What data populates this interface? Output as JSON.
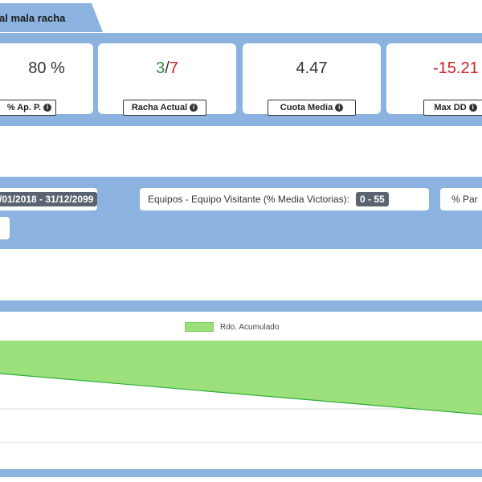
{
  "tab": {
    "label": "al mala racha"
  },
  "stats": [
    {
      "value": "80 %",
      "label": "% Ap. P.",
      "color": "#333333"
    },
    {
      "value_good": "3",
      "value_sep": "/",
      "value_bad": "7",
      "label": "Racha Actual"
    },
    {
      "value": "4.47",
      "label": "Cuota Media",
      "color": "#333333"
    },
    {
      "value": "-15.21",
      "label": "Max DD",
      "color": "#cc2222"
    }
  ],
  "colors": {
    "band": "#8cb3df",
    "positive": "#3a8a3a",
    "negative": "#cc2222",
    "area": "#9be07a",
    "area_line": "#2fae3a"
  },
  "filters": {
    "date_range": "/01/2018 - 31/12/2099",
    "equipos_label": "Equipos - Equipo Visitante (% Media Victorias):",
    "equipos_value": "0 - 55",
    "pct_label": "% Par"
  },
  "chart_data": {
    "type": "area",
    "series": [
      {
        "name": "Rdo. Acumulado"
      }
    ],
    "grid": true
  }
}
